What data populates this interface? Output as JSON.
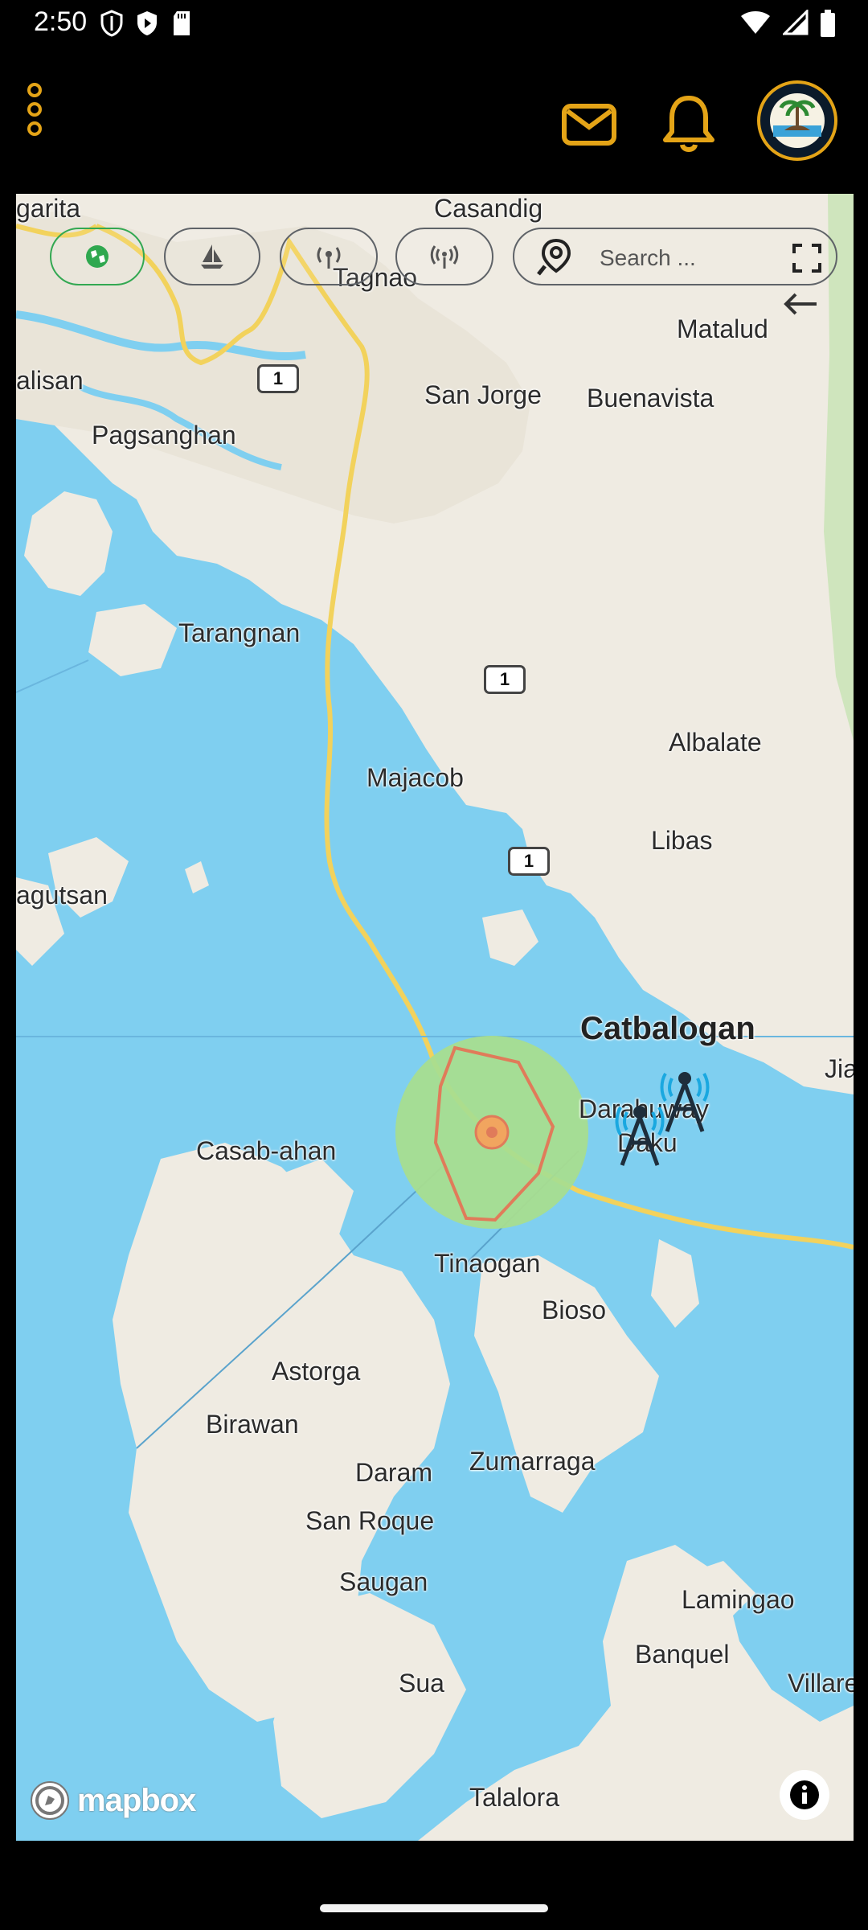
{
  "status_bar": {
    "time": "2:50"
  },
  "header": {
    "menu_icon": "more-vert-icon",
    "mail_icon": "mail-icon",
    "notification_icon": "bell-icon",
    "avatar_icon": "municipal-seal-icon",
    "accent_color": "#e4a417"
  },
  "map_toolbar": {
    "buttons": [
      {
        "icon": "globe-layer-icon",
        "active": true
      },
      {
        "icon": "sailboat-icon",
        "active": false
      },
      {
        "icon": "antenna-icon",
        "active": false
      },
      {
        "icon": "antenna-signal-icon",
        "active": false
      }
    ],
    "search_placeholder": "Search ...",
    "search_icon": "location-search-icon",
    "fullscreen_icon": "fullscreen-icon",
    "back_icon": "arrow-back-icon"
  },
  "map": {
    "places": [
      {
        "id": "sagarita",
        "label": "garita"
      },
      {
        "id": "casandig",
        "label": "Casandig"
      },
      {
        "id": "tagnao",
        "label": "Tagnao"
      },
      {
        "id": "matalud",
        "label": "Matalud"
      },
      {
        "id": "calisan",
        "label": "alisan"
      },
      {
        "id": "san-jorge",
        "label": "San Jorge"
      },
      {
        "id": "buenavista",
        "label": "Buenavista"
      },
      {
        "id": "pagsanghan",
        "label": "Pagsanghan"
      },
      {
        "id": "tarangnan",
        "label": "Tarangnan"
      },
      {
        "id": "albalate",
        "label": "Albalate"
      },
      {
        "id": "majacob",
        "label": "Majacob"
      },
      {
        "id": "libas",
        "label": "Libas"
      },
      {
        "id": "agutsan",
        "label": "agutsan"
      },
      {
        "id": "catbalogan",
        "label": "Catbalogan"
      },
      {
        "id": "jia",
        "label": "Jia"
      },
      {
        "id": "darahuway",
        "label": "Darahuway"
      },
      {
        "id": "daku",
        "label": "Daku"
      },
      {
        "id": "casab-ahan",
        "label": "Casab-ahan"
      },
      {
        "id": "tinaogan",
        "label": "Tinaogan"
      },
      {
        "id": "bioso",
        "label": "Bioso"
      },
      {
        "id": "astorga",
        "label": "Astorga"
      },
      {
        "id": "birawan",
        "label": "Birawan"
      },
      {
        "id": "daram",
        "label": "Daram"
      },
      {
        "id": "zumarraga",
        "label": "Zumarraga"
      },
      {
        "id": "san-roque",
        "label": "San Roque"
      },
      {
        "id": "saugan",
        "label": "Saugan"
      },
      {
        "id": "lamingao",
        "label": "Lamingao"
      },
      {
        "id": "banquel",
        "label": "Banquel"
      },
      {
        "id": "villarea",
        "label": "Villarea"
      },
      {
        "id": "sua",
        "label": "Sua"
      },
      {
        "id": "talalora",
        "label": "Talalora"
      }
    ],
    "road_shields": [
      "1",
      "1",
      "1"
    ],
    "colors": {
      "water": "#7fcff0",
      "land": "#efebe2",
      "road": "#f2d25c",
      "zone": "#a8dd8f",
      "zone_border": "#e07b5a"
    },
    "attribution": "mapbox"
  }
}
